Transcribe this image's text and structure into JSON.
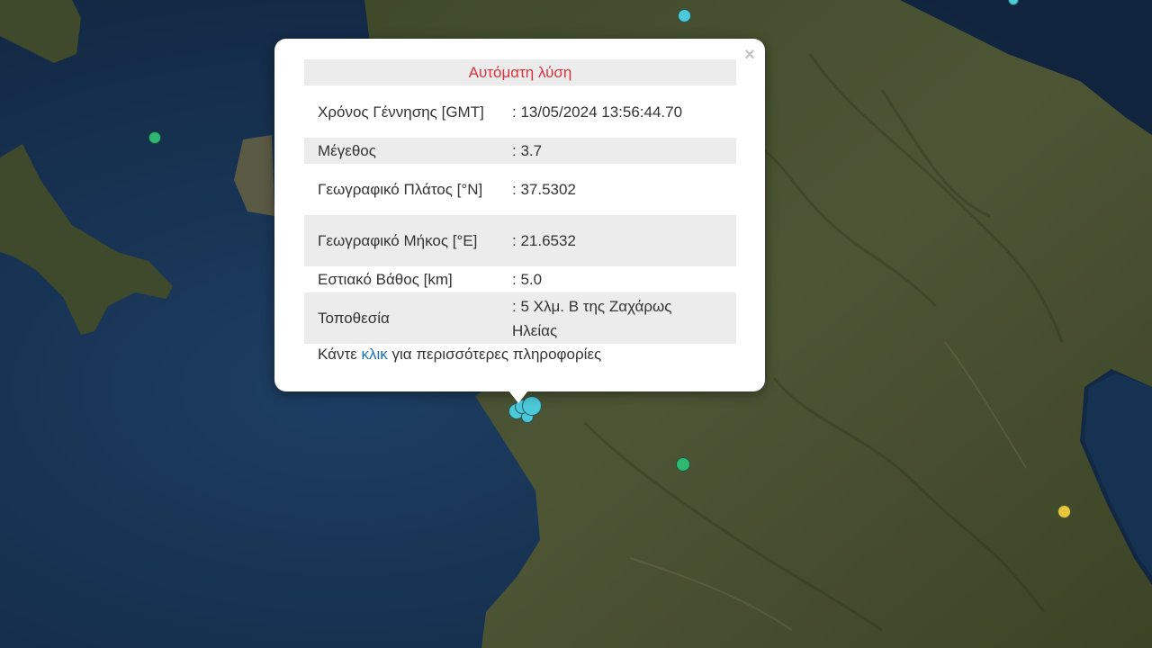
{
  "popup": {
    "title": "Αυτόματη λύση",
    "close_symbol": "×",
    "rows": [
      {
        "label": "Χρόνος Γέννησης [GMT]",
        "value": ": 13/05/2024 13:56:44.70"
      },
      {
        "label": "Μέγεθος",
        "value": ": 3.7"
      },
      {
        "label": "Γεωγραφικό Πλάτος [°N]",
        "value": ": 37.5302"
      },
      {
        "label": "Γεωγραφικό Μήκος [°E]",
        "value": ": 21.6532"
      },
      {
        "label": "Εστιακό Βάθος [km]",
        "value": ": 5.0"
      },
      {
        "label": "Τοποθεσία",
        "value": ": 5 Χλμ. Β της Ζαχάρως Ηλείας"
      }
    ],
    "more_prefix": "Κάντε ",
    "more_link": "κλικ",
    "more_suffix": " για περισσότερες πληροφορίες"
  },
  "colors": {
    "title_red": "#e0303a",
    "link_blue": "#1b6fb5",
    "marker_cyan": "#4cc9d9",
    "marker_green": "#2eb872",
    "marker_yellow": "#e6c63a"
  },
  "markers": [
    {
      "name": "marker-cyan",
      "color": "marker_cyan"
    },
    {
      "name": "marker-cyan",
      "color": "marker_cyan"
    },
    {
      "name": "marker-green",
      "color": "marker_green"
    },
    {
      "name": "marker-green",
      "color": "marker_green"
    },
    {
      "name": "marker-yellow",
      "color": "marker_yellow"
    },
    {
      "name": "marker-cyan-cluster",
      "color": "marker_cyan"
    },
    {
      "name": "marker-cyan-cluster",
      "color": "marker_cyan"
    },
    {
      "name": "marker-cyan-cluster",
      "color": "marker_cyan"
    },
    {
      "name": "marker-cyan-cluster",
      "color": "marker_cyan"
    }
  ]
}
